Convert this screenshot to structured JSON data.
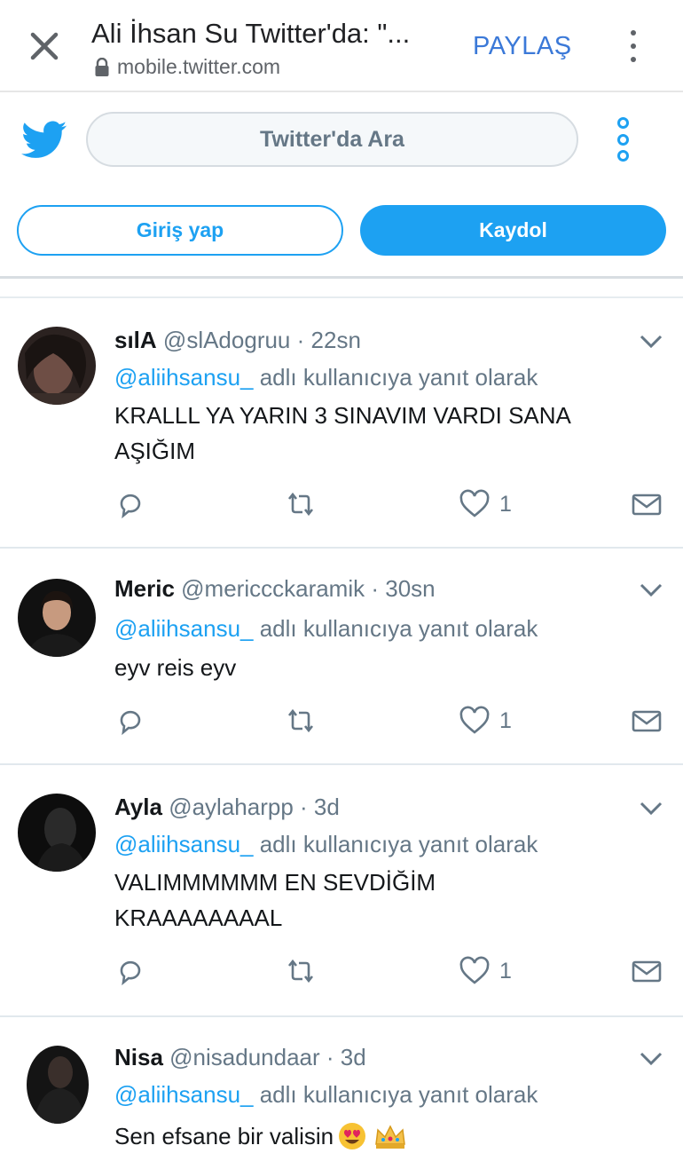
{
  "browser": {
    "title": "Ali İhsan Su Twitter'da: \"...",
    "url": "mobile.twitter.com",
    "share_label": "PAYLAŞ"
  },
  "twitter_header": {
    "search_placeholder": "Twitter'da Ara",
    "login_label": "Giriş yap",
    "signup_label": "Kaydol"
  },
  "colors": {
    "twitter_blue": "#1da1f2",
    "text_dark": "#14171a",
    "text_gray": "#657786"
  },
  "tweets": [
    {
      "name": "sılA",
      "handle": "@slAdogruu",
      "time": "· 22sn",
      "reply_mention": "@aliihsansu_",
      "reply_suffix": "adlı kullanıcıya yanıt olarak",
      "text": "KRALLL YA YARIN 3 SINAVIM VARDI SANA AŞIĞIM",
      "likes": "1"
    },
    {
      "name": "Meric",
      "handle": "@mericcckaramik",
      "time": "· 30sn",
      "reply_mention": "@aliihsansu_",
      "reply_suffix": "adlı kullanıcıya yanıt olarak",
      "text": "eyv reis eyv",
      "likes": "1"
    },
    {
      "name": "Ayla",
      "handle": "@aylaharpp",
      "time": "· 3d",
      "reply_mention": "@aliihsansu_",
      "reply_suffix": "adlı kullanıcıya yanıt olarak",
      "text": "VALIMMMMMM EN SEVDİĞİM KRAAAAAAAAL",
      "likes": "1"
    },
    {
      "name": "Nisa",
      "handle": "@nisadundaar",
      "time": "· 3d",
      "reply_mention": "@aliihsansu_",
      "reply_suffix": "adlı kullanıcıya yanıt olarak",
      "text": "Sen efsane bir valisin",
      "emoji": [
        "heart-eyes-emoji",
        "crown-emoji"
      ]
    }
  ]
}
